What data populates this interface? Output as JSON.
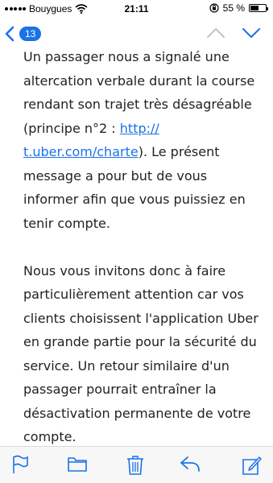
{
  "status_bar": {
    "carrier": "Bouygues",
    "time": "21:11",
    "battery_percent": "55 %",
    "battery_level": 0.55
  },
  "nav": {
    "unread_count": "13",
    "accent": "#1a73e8"
  },
  "message": {
    "para1_text_a": "Un passager nous a signalé une altercation verbale durant la course rendant son trajet très désagréable (principe n°2 : ",
    "para1_link": "http:// t.uber.com/charte",
    "para1_text_b": "). Le présent message a pour but de vous informer afin que vous puissiez en tenir compte.",
    "para2": "Nous vous invitons donc à faire particulièrement attention car vos clients choisissent l'application Uber en grande partie pour la sécurité du service. Un retour similaire d'un passager pourrait entraîner la désactivation permanente de votre compte."
  },
  "toolbar": {
    "icons": [
      "flag-icon",
      "folder-icon",
      "trash-icon",
      "reply-icon",
      "compose-icon"
    ]
  }
}
